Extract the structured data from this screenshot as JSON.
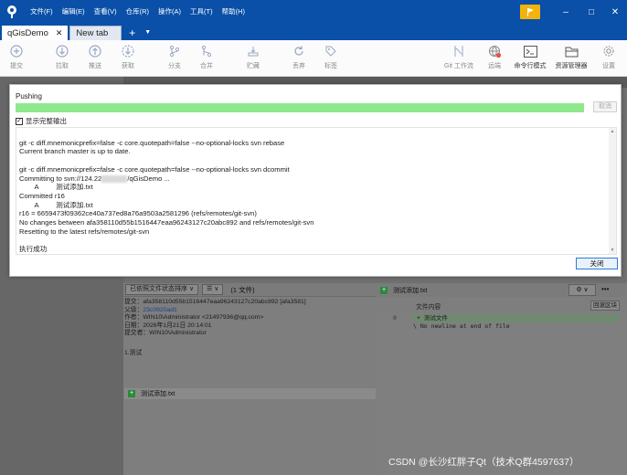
{
  "app": {
    "menu": [
      "文件(F)",
      "编辑(E)",
      "查看(V)",
      "仓库(R)",
      "操作(A)",
      "工具(T)",
      "帮助(H)"
    ],
    "window_controls": {
      "minimize": "–",
      "maximize": "□",
      "close": "✕"
    }
  },
  "tabs": [
    {
      "label": "qGisDemo",
      "close": "✕"
    },
    {
      "label": "New tab"
    }
  ],
  "tab_add": "+",
  "tab_dropdown": "▼",
  "toolbar": {
    "commit": "提交",
    "pull": "拉取",
    "push": "推送",
    "fetch": "获取",
    "branch": "分支",
    "merge": "合并",
    "stash": "贮藏",
    "discard": "丢弃",
    "tag": "标签",
    "git_flow": "Git 工作流",
    "remote": "远端",
    "terminal": "命令行模式",
    "explorer": "资源管理器",
    "settings": "设置"
  },
  "dialog": {
    "title": "Pushing",
    "progress_fraction": 1.0,
    "cancel_label": "取消",
    "show_full_output_label": "显示完整输出",
    "show_full_output_checked": "✓",
    "output_lines": [
      "git -c diff.mnemonicprefix=false -c core.quotepath=false --no-optional-locks svn rebase",
      "Current branch master is up to date.",
      "",
      "git -c diff.mnemonicprefix=false -c core.quotepath=false --no-optional-locks svn dcommit",
      "Committing to svn://124.22",
      "        A         测试添加.txt",
      "Committed r16",
      "        A         测试添加.txt",
      "r16 = 6659473f09362ce40a737ed8a76a9503a2581296 (refs/remotes/git-svn)",
      "No changes between afa358110d55b1516447eaa96243127c20abc892 and refs/remotes/git-svn",
      "Resetting to the latest refs/remotes/git-svn",
      "",
      "执行成功"
    ],
    "committing_tail": "/qGisDemo ...",
    "close_label": "关闭"
  },
  "lower_panel": {
    "sort_label": "已依照文件状态排序 ∨",
    "view_label": "☰ ∨",
    "file_count": "(1 文件)",
    "commit": {
      "commit_line": "提交：afa358110d55b1516447eaa96243127c20abc892 [afa3581]",
      "parent_label": "父级：",
      "parent_value": "23c0920ad1",
      "author": "作者：WIN10\\Administrator <21497936@qq.com>",
      "date": "日期：2026年1月21日 20:14:01",
      "committer": "提交者：WIN10\\Administrator"
    },
    "message": "1.测试",
    "file_name": "测试添加.txt",
    "file_plus": "+"
  },
  "right_panel": {
    "file_name": "测试添加.txt",
    "file_plus": "+",
    "content_label": "文件内容",
    "revert_label": "回滚区块",
    "line_number": "0",
    "added_line": "+ 测试文件",
    "no_newline": "\\  No newline at end of file",
    "more": "•••",
    "gear": "⚙ ∨"
  },
  "watermark": "CSDN @长沙红胖子Qt（技术Q群4597637）",
  "colors": {
    "title_bar": "#0a4fa8",
    "progress": "#8fe88c",
    "flag": "#f2b40c",
    "primary_button_border": "#2f7ad6"
  }
}
